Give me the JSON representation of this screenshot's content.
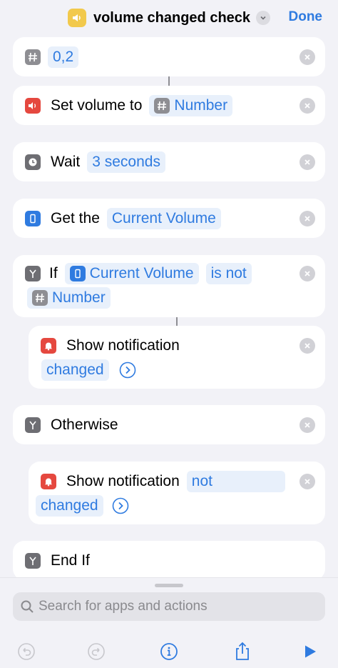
{
  "header": {
    "title": "volume changed check",
    "done_label": "Done",
    "app_icon": "speaker-icon",
    "app_icon_color": "#f2c94c"
  },
  "actions": {
    "number": {
      "value": "0,2"
    },
    "set_volume": {
      "label": "Set volume to",
      "token": "Number"
    },
    "wait": {
      "label": "Wait",
      "token": "3 seconds"
    },
    "get_volume": {
      "label": "Get the",
      "token": "Current Volume"
    },
    "if_block": {
      "label": "If",
      "token_volume": "Current Volume",
      "token_condition": "is not",
      "token_number": "Number"
    },
    "show_notification_1": {
      "label": "Show notification",
      "token": "changed"
    },
    "otherwise": {
      "label": "Otherwise"
    },
    "show_notification_2": {
      "label": "Show notification",
      "token_line1": "not",
      "token_line2": "changed"
    },
    "end_if": {
      "label": "End If"
    }
  },
  "search": {
    "placeholder": "Search for apps and actions"
  },
  "toolbar": [
    "undo-icon",
    "redo-icon",
    "info-icon",
    "share-icon",
    "play-icon"
  ],
  "colors": {
    "accent": "#2f7be0",
    "token_bg": "#e8f0fb",
    "scripting_gray": "#8e8e93",
    "red": "#e5483f"
  }
}
